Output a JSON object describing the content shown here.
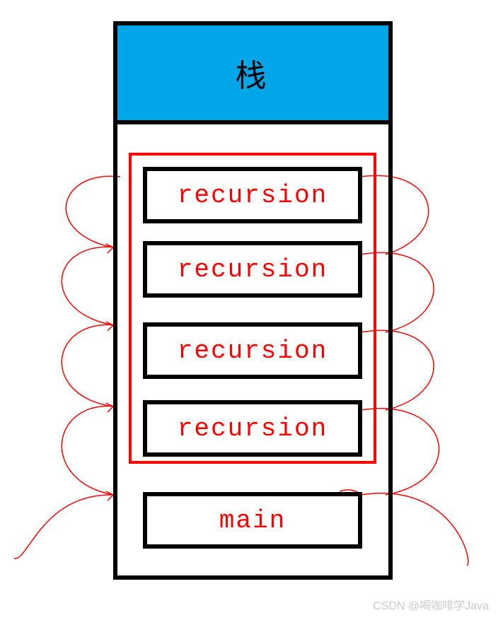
{
  "stack": {
    "title": "栈",
    "frames": [
      {
        "label": "recursion"
      },
      {
        "label": "recursion"
      },
      {
        "label": "recursion"
      },
      {
        "label": "recursion"
      },
      {
        "label": "main"
      }
    ]
  },
  "watermark": "CSDN @喝咖啡学Java"
}
